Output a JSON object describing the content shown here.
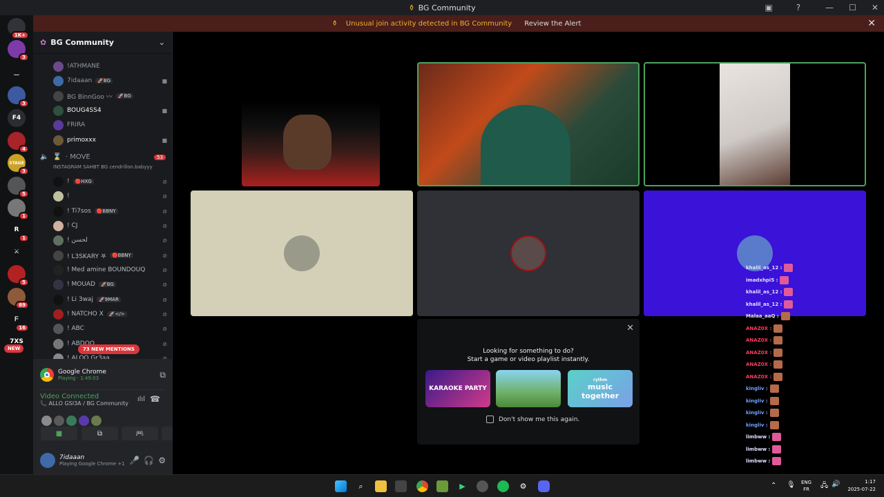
{
  "window": {
    "title": "BG Community"
  },
  "alert": {
    "text": "Unusual join activity detected in BG Community",
    "action": "Review the Alert"
  },
  "servers": [
    {
      "label": "",
      "badge": "1K+",
      "color": "#313338"
    },
    {
      "label": "",
      "badge": "3",
      "color": "#7d3aa8"
    },
    {
      "label": "‿",
      "badge": "",
      "color": "#111214"
    },
    {
      "label": "",
      "badge": "3",
      "color": "#3c5aa0"
    },
    {
      "label": "F4",
      "badge": "",
      "color": "#2b2d31"
    },
    {
      "label": "",
      "badge": "4",
      "color": "#a8232a"
    },
    {
      "label": "STAGE",
      "badge": "3",
      "color": "#c9a227"
    },
    {
      "label": "",
      "badge": "5",
      "color": "#555"
    },
    {
      "label": "",
      "badge": "1",
      "color": "#777"
    },
    {
      "label": "R",
      "badge": "1",
      "color": "#111214"
    },
    {
      "label": "⚔",
      "badge": "",
      "color": "#111214"
    },
    {
      "label": "",
      "badge": "5",
      "color": "#b22222"
    },
    {
      "label": "",
      "badge": "69",
      "color": "#8e5a3a"
    },
    {
      "label": "ᖴ",
      "badge": "16",
      "color": "#111214"
    },
    {
      "label": "7XS",
      "badge": "",
      "color": "#111214"
    }
  ],
  "new_badge": "NEW",
  "sidebar": {
    "guild_name": "BG Community",
    "users_top": [
      {
        "name": "!ATHMANE",
        "tag": "",
        "color": "#6b4a8a",
        "video": false
      },
      {
        "name": "7idaaan",
        "tag": "🚀BG",
        "color": "#3e6aa8",
        "video": true
      },
      {
        "name": "BG BinnGoo 〰",
        "tag": "🚀BG",
        "color": "#444",
        "video": false
      },
      {
        "name": "BOUG4SS4",
        "tag": "",
        "color": "#2f4f3f",
        "video": true
      },
      {
        "name": "FRIRA",
        "tag": "",
        "color": "#5a3a9a",
        "video": false
      },
      {
        "name": "primoxxx",
        "tag": "",
        "color": "#6a5a3a",
        "video": true
      }
    ],
    "voice_channel": {
      "name": "MOVE",
      "count": "53",
      "subtitle": "INSTAGRAM SAHBT BG cendrillon.babyyy"
    },
    "users_vc": [
      {
        "name": "!",
        "tag": "🔴HXG",
        "color": "#111"
      },
      {
        "name": "!",
        "tag": "",
        "color": "#c0c0a0"
      },
      {
        "name": "! Ti7sos",
        "tag": "🔴BBNY",
        "color": "#111"
      },
      {
        "name": "! CJ",
        "tag": "",
        "color": "#d0b0a0"
      },
      {
        "name": "! لحسن",
        "tag": "",
        "color": "#607060"
      },
      {
        "name": "! L3SKARY 𖤐",
        "tag": "🔴BBNY",
        "color": "#444"
      },
      {
        "name": "! Med amine BOUNDOUQ",
        "tag": "",
        "color": "#222"
      },
      {
        "name": "! MOUAD",
        "tag": "🚀BG",
        "color": "#334"
      },
      {
        "name": "! Li 3waj",
        "tag": "🚀9MAR",
        "color": "#111"
      },
      {
        "name": "! NATCHO X",
        "tag": "🚀</>",
        "color": "#a02020"
      },
      {
        "name": "! ABC",
        "tag": "",
        "color": "#555"
      },
      {
        "name": "! ABDOO",
        "tag": "",
        "color": "#777"
      },
      {
        "name": "! ALOO Gr3aa",
        "tag": "",
        "color": "#888"
      }
    ],
    "mentions": "73 NEW MENTIONS",
    "activity": {
      "app": "Google Chrome",
      "status": "Playing · 1:49:03"
    },
    "voice": {
      "status": "Video Connected",
      "channel": "ALLO GSI3A / BG Community"
    },
    "user": {
      "name": "7idaaan",
      "status": "Playing Google Chrome",
      "extra": "+1"
    }
  },
  "activity_popup": {
    "line1": "Looking for something to do?",
    "line2": "Start a game or video playlist instantly.",
    "cards": [
      {
        "label": "KARAOKE PARTY",
        "color": "#d13a8a"
      },
      {
        "label": "",
        "color": "#6fb06a"
      },
      {
        "label": "music together",
        "prefix": "rythm",
        "color": "#5ad1c8"
      }
    ],
    "checkbox_label": "Don't show me this again."
  },
  "chat_overlay": [
    {
      "user": "khalil_as_12 :",
      "color": "#e0e0ff",
      "emote": "🦩"
    },
    {
      "user": "imadxhpi5 :",
      "color": "#e0e0ff",
      "emote": "🦩"
    },
    {
      "user": "khalil_as_12 :",
      "color": "#e0e0ff",
      "emote": "🦩"
    },
    {
      "user": "khalil_as_12 :",
      "color": "#e0e0ff",
      "emote": "🦩"
    },
    {
      "user": "Malaa_aaQ :",
      "color": "#e0e0ff",
      "emote": ""
    },
    {
      "user": "ANAZ0X :",
      "color": "#ff3b5c",
      "emote": ""
    },
    {
      "user": "ANAZ0X :",
      "color": "#ff3b5c",
      "emote": ""
    },
    {
      "user": "ANAZ0X :",
      "color": "#ff3b5c",
      "emote": ""
    },
    {
      "user": "ANAZ0X :",
      "color": "#ff3b5c",
      "emote": ""
    },
    {
      "user": "ANAZ0X :",
      "color": "#ff3b5c",
      "emote": ""
    },
    {
      "user": "kingliv :",
      "color": "#6fa0ff",
      "emote": ""
    },
    {
      "user": "kingliv :",
      "color": "#6fa0ff",
      "emote": ""
    },
    {
      "user": "kingliv :",
      "color": "#6fa0ff",
      "emote": ""
    },
    {
      "user": "kingliv :",
      "color": "#6fa0ff",
      "emote": ""
    },
    {
      "user": "limbww :",
      "color": "#e0e0ff",
      "emote": "🟢"
    },
    {
      "user": "limbww :",
      "color": "#e0e0ff",
      "emote": "🟢"
    },
    {
      "user": "limbww :",
      "color": "#e0e0ff",
      "emote": "🟢"
    }
  ],
  "taskbar": {
    "lang": "ENG",
    "region": "FR",
    "time": "1:17",
    "date": "2025-07-22"
  },
  "icons": {
    "accent": "#5865f2",
    "speaking_green": "#4ca45a",
    "danger": "#da373c"
  }
}
